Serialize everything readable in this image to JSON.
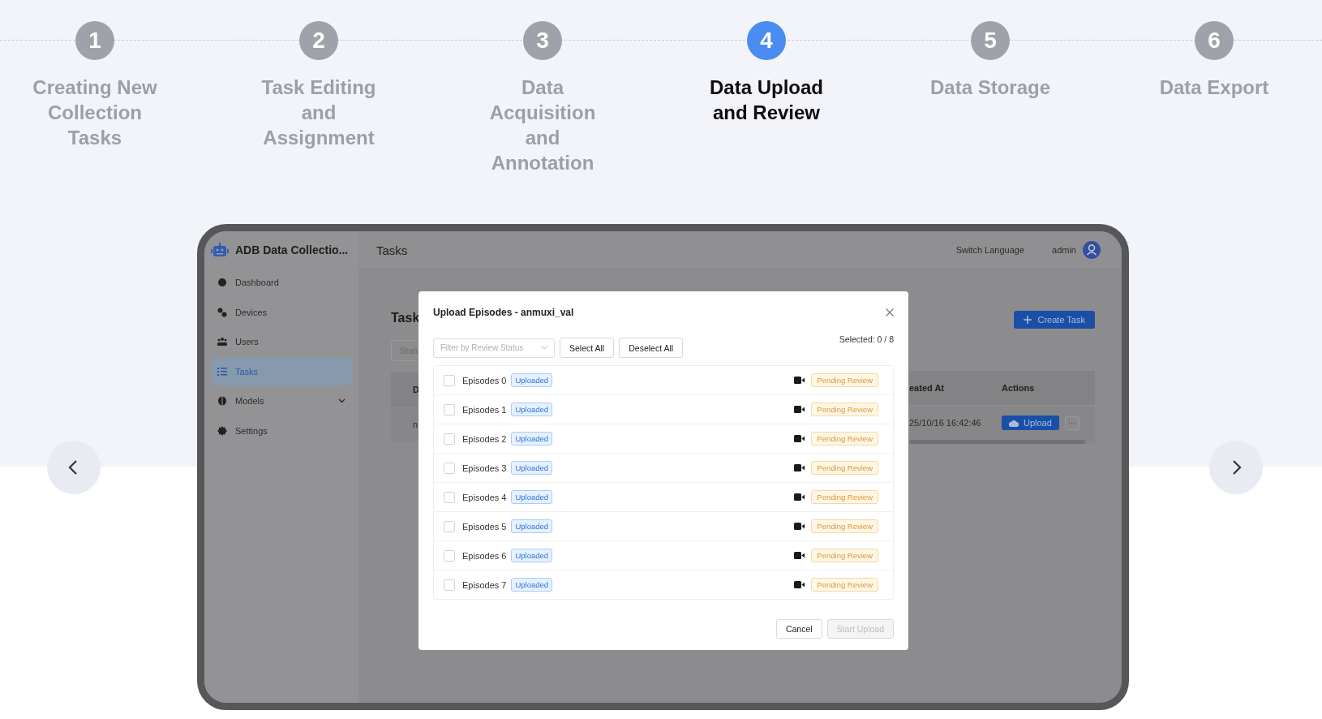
{
  "steps": [
    {
      "number": "1",
      "label": "Creating New Collection Tasks",
      "selected": false
    },
    {
      "number": "2",
      "label": "Task Editing and Assignment",
      "selected": false
    },
    {
      "number": "3",
      "label": "Data Acquisition and Annotation",
      "selected": false
    },
    {
      "number": "4",
      "label": "Data Upload and Review",
      "selected": true
    },
    {
      "number": "5",
      "label": "Data Storage",
      "selected": false
    },
    {
      "number": "6",
      "label": "Data Export",
      "selected": false
    }
  ],
  "app": {
    "brand": "ADB Data Collectio...",
    "sidebar": {
      "items": [
        {
          "label": "Dashboard",
          "selected": false,
          "has_submenu": false
        },
        {
          "label": "Devices",
          "selected": false,
          "has_submenu": false
        },
        {
          "label": "Users",
          "selected": false,
          "has_submenu": false
        },
        {
          "label": "Tasks",
          "selected": true,
          "has_submenu": false
        },
        {
          "label": "Models",
          "selected": false,
          "has_submenu": true
        },
        {
          "label": "Settings",
          "selected": false,
          "has_submenu": false
        }
      ]
    },
    "header": {
      "title": "Tasks",
      "switch_language": "Switch Language",
      "user": "admin"
    },
    "page": {
      "heading": "Task",
      "status_filter": {
        "placeholder": "Statu"
      },
      "create_button": "Create Task",
      "table": {
        "columns": [
          "D",
          "eated At",
          "Actions"
        ],
        "rows": [
          {
            "cells": [
              "n",
              "25/10/16 16:42:46"
            ],
            "upload_button": "Upload",
            "more_button": "···"
          }
        ]
      }
    }
  },
  "modal": {
    "title": "Upload Episodes - anmuxi_val",
    "filter": {
      "placeholder": "Filter by Review Status"
    },
    "select_all": "Select All",
    "deselect_all": "Deselect All",
    "selected_count": "Selected: 0 / 8",
    "episodes": [
      {
        "name": "Episodes 0",
        "checked": false,
        "upload_status": "Uploaded",
        "review_status": "Pending Review"
      },
      {
        "name": "Episodes 1",
        "checked": false,
        "upload_status": "Uploaded",
        "review_status": "Pending Review"
      },
      {
        "name": "Episodes 2",
        "checked": false,
        "upload_status": "Uploaded",
        "review_status": "Pending Review"
      },
      {
        "name": "Episodes 3",
        "checked": false,
        "upload_status": "Uploaded",
        "review_status": "Pending Review"
      },
      {
        "name": "Episodes 4",
        "checked": false,
        "upload_status": "Uploaded",
        "review_status": "Pending Review"
      },
      {
        "name": "Episodes 5",
        "checked": false,
        "upload_status": "Uploaded",
        "review_status": "Pending Review"
      },
      {
        "name": "Episodes 6",
        "checked": false,
        "upload_status": "Uploaded",
        "review_status": "Pending Review"
      },
      {
        "name": "Episodes 7",
        "checked": false,
        "upload_status": "Uploaded",
        "review_status": "Pending Review"
      }
    ],
    "cancel": "Cancel",
    "start_upload": {
      "label": "Start Upload",
      "disabled": true
    }
  }
}
